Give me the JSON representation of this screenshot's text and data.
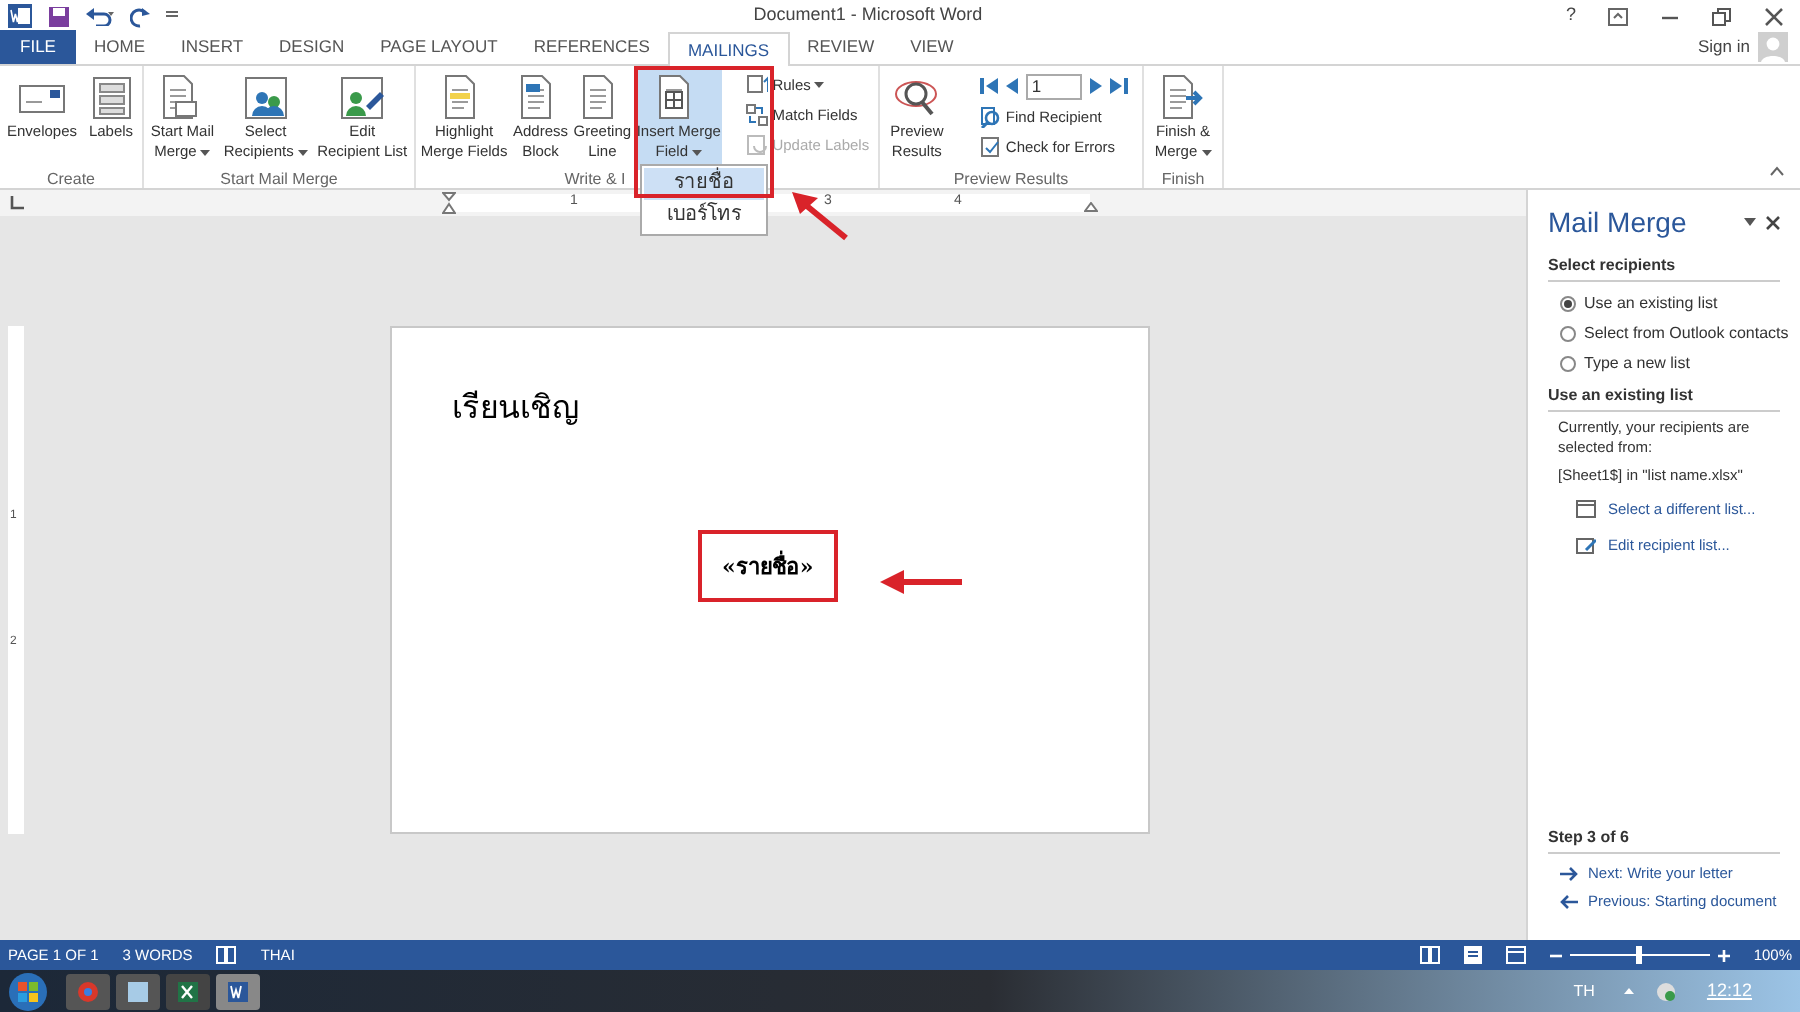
{
  "window": {
    "title": "Document1 - Microsoft Word",
    "help": "?"
  },
  "tabs": [
    {
      "label": "FILE",
      "kind": "file",
      "selected": false
    },
    {
      "label": "HOME",
      "kind": "tab",
      "selected": false
    },
    {
      "label": "INSERT",
      "kind": "tab",
      "selected": false
    },
    {
      "label": "DESIGN",
      "kind": "tab",
      "selected": false
    },
    {
      "label": "PAGE LAYOUT",
      "kind": "tab",
      "selected": false
    },
    {
      "label": "REFERENCES",
      "kind": "tab",
      "selected": false
    },
    {
      "label": "MAILINGS",
      "kind": "tab",
      "selected": true
    },
    {
      "label": "REVIEW",
      "kind": "tab",
      "selected": false
    },
    {
      "label": "VIEW",
      "kind": "tab",
      "selected": false
    }
  ],
  "account": {
    "label": "Sign in"
  },
  "ribbon": {
    "groups": [
      {
        "label": "Create",
        "items": [
          {
            "kind": "large",
            "lines": [
              "Envelopes"
            ],
            "dropdown": false,
            "pressed": false
          },
          {
            "kind": "large",
            "lines": [
              "Labels"
            ],
            "dropdown": false,
            "pressed": false
          }
        ]
      },
      {
        "label": "Start Mail Merge",
        "items": [
          {
            "kind": "large",
            "lines": [
              "Start Mail",
              "Merge"
            ],
            "dropdown": true,
            "pressed": false
          },
          {
            "kind": "large",
            "lines": [
              "Select",
              "Recipients"
            ],
            "dropdown": true,
            "pressed": false
          },
          {
            "kind": "large",
            "lines": [
              "Edit",
              "Recipient List"
            ],
            "dropdown": false,
            "pressed": false
          }
        ]
      },
      {
        "label": "Write & I",
        "items": [
          {
            "kind": "large",
            "lines": [
              "Highlight",
              "Merge Fields"
            ],
            "dropdown": false,
            "pressed": false
          },
          {
            "kind": "large",
            "lines": [
              "Address",
              "Block"
            ],
            "dropdown": false,
            "pressed": false
          },
          {
            "kind": "large",
            "lines": [
              "Greeting",
              "Line"
            ],
            "dropdown": false,
            "pressed": false
          },
          {
            "kind": "large",
            "lines": [
              "Insert Merge",
              "Field"
            ],
            "dropdown": true,
            "pressed": true
          },
          {
            "kind": "stack",
            "rows": [
              {
                "label": "Rules",
                "dropdown": true,
                "disabled": false
              },
              {
                "label": "Match Fields",
                "dropdown": false,
                "disabled": false
              },
              {
                "label": "Update Labels",
                "dropdown": false,
                "disabled": true
              }
            ]
          }
        ]
      },
      {
        "label": "Preview Results",
        "items": [
          {
            "kind": "large",
            "lines": [
              "Preview",
              "Results"
            ],
            "dropdown": false,
            "pressed": false
          },
          {
            "kind": "nav",
            "record": "1",
            "rows": [
              {
                "label": "Find Recipient",
                "dropdown": false,
                "disabled": false
              },
              {
                "label": "Check for Errors",
                "dropdown": false,
                "disabled": false
              }
            ]
          }
        ]
      },
      {
        "label": "Finish",
        "items": [
          {
            "kind": "large",
            "lines": [
              "Finish &",
              "Merge"
            ],
            "dropdown": true,
            "pressed": false
          }
        ]
      }
    ]
  },
  "dropdown_menu": {
    "items": [
      {
        "label": "รายชื่อ",
        "selected": true
      },
      {
        "label": "เบอร์โทร",
        "selected": false
      }
    ]
  },
  "ruler": {
    "marks": [
      "1",
      "3",
      "4"
    ],
    "vertical_marks": [
      "1",
      "2"
    ]
  },
  "document": {
    "greeting": "เรียนเชิญ",
    "merge_field": "«รายชื่อ»"
  },
  "task_pane": {
    "title": "Mail Merge",
    "section_1": {
      "heading": "Select recipients",
      "options": [
        {
          "label": "Use an existing list",
          "selected": true
        },
        {
          "label": "Select from Outlook contacts",
          "selected": false
        },
        {
          "label": "Type a new list",
          "selected": false
        }
      ]
    },
    "section_2": {
      "heading": "Use an existing list",
      "description": "Currently, your recipients are selected from:",
      "source": "[Sheet1$] in \"list name.xlsx\"",
      "links": [
        "Select a different list...",
        "Edit recipient list..."
      ]
    },
    "step": {
      "heading": "Step 3 of 6",
      "next": "Next: Write your letter",
      "previous": "Previous: Starting document"
    }
  },
  "status_bar": {
    "page": "PAGE 1 OF 1",
    "words": "3 WORDS",
    "language": "THAI",
    "zoom": "100%",
    "zoom_level": {
      "level": 0.5
    }
  },
  "taskbar": {
    "language": "TH",
    "time": "12:12"
  }
}
